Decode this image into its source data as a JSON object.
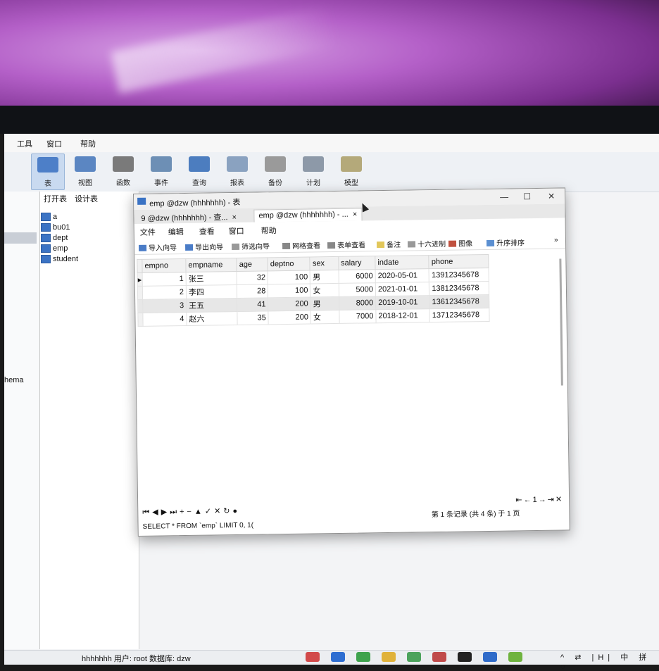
{
  "main_menu": [
    "工具",
    "窗口",
    "帮助"
  ],
  "ribbon": [
    {
      "label": "表",
      "icon": "table-icon",
      "active": true
    },
    {
      "label": "视图",
      "icon": "view-icon"
    },
    {
      "label": "函数",
      "icon": "function-icon"
    },
    {
      "label": "事件",
      "icon": "event-icon"
    },
    {
      "label": "查询",
      "icon": "query-icon"
    },
    {
      "label": "报表",
      "icon": "report-icon"
    },
    {
      "label": "备份",
      "icon": "backup-icon"
    },
    {
      "label": "计划",
      "icon": "schedule-icon"
    },
    {
      "label": "模型",
      "icon": "model-icon"
    }
  ],
  "object_toolbar": {
    "open": "打开表",
    "design": "设计表"
  },
  "tables": [
    "a",
    "bu01",
    "dept",
    "emp",
    "student"
  ],
  "left_label": "hema",
  "window": {
    "title": "emp @dzw (hhhhhhh) - 表",
    "tabs": [
      "9 @dzw (hhhhhhh) - 查...",
      "emp @dzw (hhhhhhh) - ..."
    ],
    "menu": [
      "文件",
      "编辑",
      "查看",
      "窗口",
      "帮助"
    ],
    "toolbar": [
      "导入向导",
      "导出向导",
      "筛选向导",
      "网格查看",
      "表单查看",
      "备注",
      "十六进制",
      "图像",
      "升序排序"
    ],
    "columns": [
      "empno",
      "empname",
      "age",
      "deptno",
      "sex",
      "salary",
      "indate",
      "phone"
    ],
    "rows": [
      [
        "1",
        "张三",
        "32",
        "100",
        "男",
        "6000",
        "2020-05-01",
        "13912345678"
      ],
      [
        "2",
        "李四",
        "28",
        "100",
        "女",
        "5000",
        "2021-01-01",
        "13812345678"
      ],
      [
        "3",
        "王五",
        "41",
        "200",
        "男",
        "8000",
        "2019-10-01",
        "13612345678"
      ],
      [
        "4",
        "赵六",
        "35",
        "200",
        "女",
        "7000",
        "2018-12-01",
        "13712345678"
      ]
    ],
    "page": "1",
    "record_info": "第 1 条记录 (共 4 条) 于 1 页",
    "sql": "SELECT * FROM `emp` LIMIT 0, 1("
  },
  "status": "hhhhhhh   用户: root   数据库: dzw",
  "tray": "^ ⇄ |H| 中 拼 ◌",
  "colors": {
    "accent": "#3b73c4",
    "active_ribbon": "#c9daf0"
  }
}
